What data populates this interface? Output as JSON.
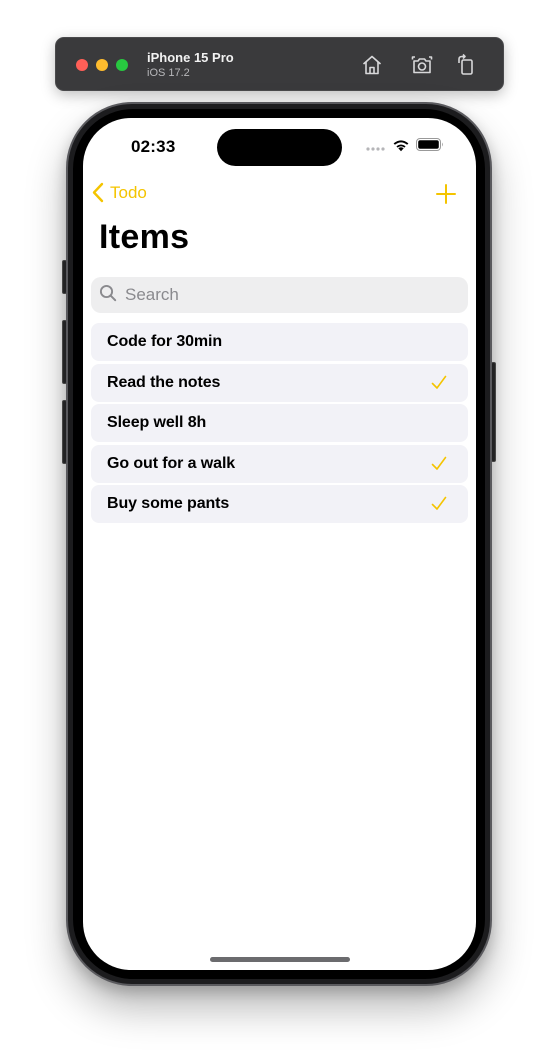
{
  "simulator": {
    "device_name": "iPhone 15 Pro",
    "os_version": "iOS 17.2",
    "icons": [
      "home-icon",
      "screenshot-icon",
      "rotate-icon"
    ]
  },
  "status_bar": {
    "time": "02:33",
    "icons": [
      "cellular-icon",
      "wifi-icon",
      "battery-icon"
    ]
  },
  "nav": {
    "back_label": "Todo",
    "back_icon": "chevron-left-icon",
    "add_icon": "plus-icon",
    "title": "Items"
  },
  "search": {
    "placeholder": "Search",
    "value": ""
  },
  "accent_color": "#f4c400",
  "items": [
    {
      "title": "Code for 30min",
      "done": false
    },
    {
      "title": "Read the notes",
      "done": true
    },
    {
      "title": "Sleep well 8h",
      "done": false
    },
    {
      "title": "Go out for a walk",
      "done": true
    },
    {
      "title": "Buy some pants",
      "done": true
    }
  ]
}
